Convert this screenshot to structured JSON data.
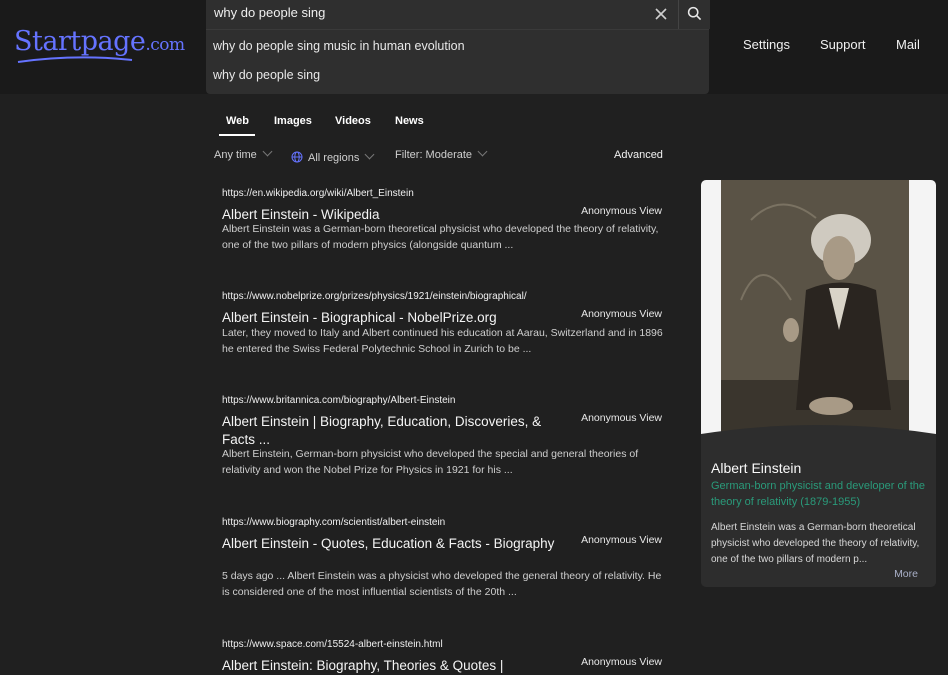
{
  "header": {
    "logo_text": "Startpage",
    "logo_suffix": ".com",
    "search_value": "why do people sing",
    "suggestions": [
      "why do people sing music in human evolution",
      "why do people sing"
    ],
    "nav": [
      "Settings",
      "Support",
      "Mail"
    ],
    "colors": {
      "brand": "#6573ff",
      "background": "#202020"
    }
  },
  "tabs": [
    "Web",
    "Images",
    "Videos",
    "News"
  ],
  "filters": {
    "time": "Any time",
    "regions": "All regions",
    "filter": "Filter: Moderate",
    "advanced": "Advanced"
  },
  "results": [
    {
      "url": "https://en.wikipedia.org/wiki/Albert_Einstein",
      "title": "Albert Einstein - Wikipedia",
      "anon": "Anonymous View",
      "desc": "Albert Einstein was a German-born theoretical physicist who developed the theory of relativity, one of the two pillars of modern physics (alongside quantum ..."
    },
    {
      "url": "https://www.nobelprize.org/prizes/physics/1921/einstein/biographical/",
      "title": "Albert Einstein - Biographical - NobelPrize.org",
      "anon": "Anonymous View",
      "desc": "Later, they moved to Italy and Albert continued his education at Aarau, Switzerland and in 1896 he entered the Swiss Federal Polytechnic School in Zurich to be ..."
    },
    {
      "url": "https://www.britannica.com/biography/Albert-Einstein",
      "title": "Albert Einstein | Biography, Education, Discoveries, & Facts ...",
      "anon": "Anonymous View",
      "desc": "Albert Einstein, German-born physicist who developed the special and general theories of relativity and won the Nobel Prize for Physics in 1921 for his ..."
    },
    {
      "url": "https://www.biography.com/scientist/albert-einstein",
      "title": "Albert Einstein - Quotes, Education & Facts - Biography",
      "anon": "Anonymous View",
      "desc": "5 days ago ... Albert Einstein was a physicist who developed the general theory of relativity. He is considered one of the most influential scientists of the 20th ..."
    },
    {
      "url": "https://www.space.com/15524-albert-einstein.html",
      "title": "Albert Einstein: Biography, Theories & Quotes |",
      "anon": "Anonymous View"
    }
  ],
  "knowledge_panel": {
    "name": "Albert Einstein",
    "subtitle": "German-born physicist and developer of the theory of relativity (1879-1955)",
    "text": "Albert Einstein was a German-born theoretical physicist who developed the theory of relativity, one of the two pillars of modern p...",
    "more": "More"
  }
}
